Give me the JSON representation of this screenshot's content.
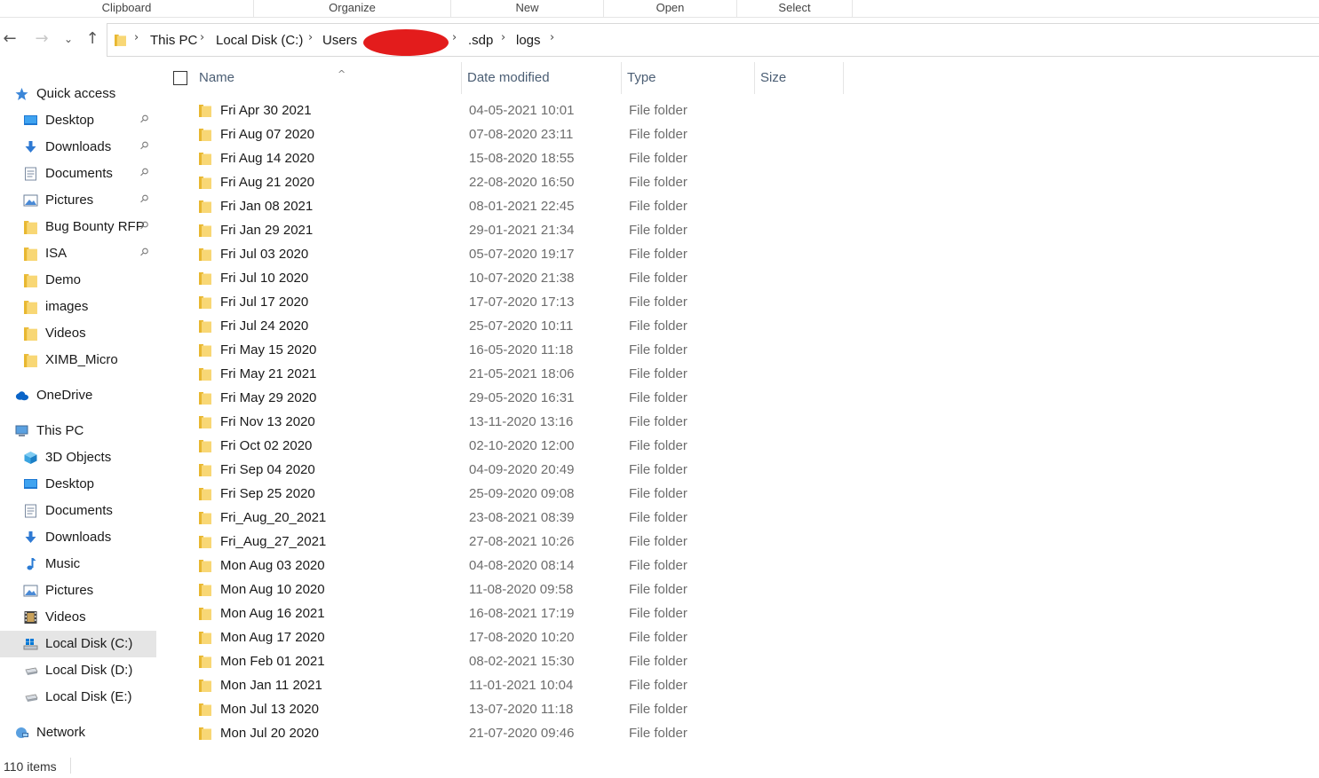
{
  "ribbon": {
    "groups": [
      "Clipboard",
      "Organize",
      "New",
      "Open",
      "Select"
    ]
  },
  "breadcrumb": {
    "items": [
      "This PC",
      "Local Disk (C:)",
      "Users",
      ".sdp",
      "logs"
    ],
    "redaction_color": "#e31c1c"
  },
  "nav": {
    "back_glyph": "←",
    "forward_glyph": "→",
    "recent_glyph": "⌄",
    "up_glyph": "↑"
  },
  "sidebar": {
    "items": [
      {
        "label": "Quick access",
        "icon": "star-icon",
        "level": 0,
        "pinned": false
      },
      {
        "label": "Desktop",
        "icon": "desktop-icon",
        "level": 1,
        "pinned": true
      },
      {
        "label": "Downloads",
        "icon": "downloads-icon",
        "level": 1,
        "pinned": true
      },
      {
        "label": "Documents",
        "icon": "documents-icon",
        "level": 1,
        "pinned": true
      },
      {
        "label": "Pictures",
        "icon": "pictures-icon",
        "level": 1,
        "pinned": true
      },
      {
        "label": "Bug Bounty RFP",
        "icon": "folder-icon",
        "level": 1,
        "pinned": true
      },
      {
        "label": "ISA",
        "icon": "folder-icon",
        "level": 1,
        "pinned": true
      },
      {
        "label": "Demo",
        "icon": "folder-icon",
        "level": 1,
        "pinned": false
      },
      {
        "label": "images",
        "icon": "folder-icon",
        "level": 1,
        "pinned": false
      },
      {
        "label": "Videos",
        "icon": "folder-icon",
        "level": 1,
        "pinned": false
      },
      {
        "label": "XIMB_Micro",
        "icon": "folder-icon",
        "level": 1,
        "pinned": false
      },
      {
        "label": "OneDrive",
        "icon": "cloud-icon",
        "level": 0,
        "pinned": false
      },
      {
        "label": "This PC",
        "icon": "computer-icon",
        "level": 0,
        "pinned": false
      },
      {
        "label": "3D Objects",
        "icon": "cube-icon",
        "level": 1,
        "pinned": false
      },
      {
        "label": "Desktop",
        "icon": "desktop-icon",
        "level": 1,
        "pinned": false
      },
      {
        "label": "Documents",
        "icon": "documents-icon",
        "level": 1,
        "pinned": false
      },
      {
        "label": "Downloads",
        "icon": "downloads-icon",
        "level": 1,
        "pinned": false
      },
      {
        "label": "Music",
        "icon": "music-icon",
        "level": 1,
        "pinned": false
      },
      {
        "label": "Pictures",
        "icon": "pictures-icon",
        "level": 1,
        "pinned": false
      },
      {
        "label": "Videos",
        "icon": "videos-icon",
        "level": 1,
        "pinned": false
      },
      {
        "label": "Local Disk (C:)",
        "icon": "windows-drive-icon",
        "level": 1,
        "pinned": false,
        "selected": true
      },
      {
        "label": "Local Disk (D:)",
        "icon": "drive-icon",
        "level": 1,
        "pinned": false
      },
      {
        "label": "Local Disk (E:)",
        "icon": "drive-icon",
        "level": 1,
        "pinned": false
      },
      {
        "label": "Network",
        "icon": "network-icon",
        "level": 0,
        "pinned": false
      }
    ],
    "pin_glyph": "📌"
  },
  "columns": {
    "name": "Name",
    "date": "Date modified",
    "type": "Type",
    "size": "Size",
    "sort_glyph": "^"
  },
  "files": [
    {
      "name": "Fri Apr 30 2021",
      "date": "04-05-2021 10:01",
      "type": "File folder"
    },
    {
      "name": "Fri Aug 07 2020",
      "date": "07-08-2020 23:11",
      "type": "File folder"
    },
    {
      "name": "Fri Aug 14 2020",
      "date": "15-08-2020 18:55",
      "type": "File folder"
    },
    {
      "name": "Fri Aug 21 2020",
      "date": "22-08-2020 16:50",
      "type": "File folder"
    },
    {
      "name": "Fri Jan 08 2021",
      "date": "08-01-2021 22:45",
      "type": "File folder"
    },
    {
      "name": "Fri Jan 29 2021",
      "date": "29-01-2021 21:34",
      "type": "File folder"
    },
    {
      "name": "Fri Jul 03 2020",
      "date": "05-07-2020 19:17",
      "type": "File folder"
    },
    {
      "name": "Fri Jul 10 2020",
      "date": "10-07-2020 21:38",
      "type": "File folder"
    },
    {
      "name": "Fri Jul 17 2020",
      "date": "17-07-2020 17:13",
      "type": "File folder"
    },
    {
      "name": "Fri Jul 24 2020",
      "date": "25-07-2020 10:11",
      "type": "File folder"
    },
    {
      "name": "Fri May 15 2020",
      "date": "16-05-2020 11:18",
      "type": "File folder"
    },
    {
      "name": "Fri May 21 2021",
      "date": "21-05-2021 18:06",
      "type": "File folder"
    },
    {
      "name": "Fri May 29 2020",
      "date": "29-05-2020 16:31",
      "type": "File folder"
    },
    {
      "name": "Fri Nov 13 2020",
      "date": "13-11-2020 13:16",
      "type": "File folder"
    },
    {
      "name": "Fri Oct 02 2020",
      "date": "02-10-2020 12:00",
      "type": "File folder"
    },
    {
      "name": "Fri Sep 04 2020",
      "date": "04-09-2020 20:49",
      "type": "File folder"
    },
    {
      "name": "Fri Sep 25 2020",
      "date": "25-09-2020 09:08",
      "type": "File folder"
    },
    {
      "name": "Fri_Aug_20_2021",
      "date": "23-08-2021 08:39",
      "type": "File folder"
    },
    {
      "name": "Fri_Aug_27_2021",
      "date": "27-08-2021 10:26",
      "type": "File folder"
    },
    {
      "name": "Mon Aug 03 2020",
      "date": "04-08-2020 08:14",
      "type": "File folder"
    },
    {
      "name": "Mon Aug 10 2020",
      "date": "11-08-2020 09:58",
      "type": "File folder"
    },
    {
      "name": "Mon Aug 16 2021",
      "date": "16-08-2021 17:19",
      "type": "File folder"
    },
    {
      "name": "Mon Aug 17 2020",
      "date": "17-08-2020 10:20",
      "type": "File folder"
    },
    {
      "name": "Mon Feb 01 2021",
      "date": "08-02-2021 15:30",
      "type": "File folder"
    },
    {
      "name": "Mon Jan 11 2021",
      "date": "11-01-2021 10:04",
      "type": "File folder"
    },
    {
      "name": "Mon Jul 13 2020",
      "date": "13-07-2020 11:18",
      "type": "File folder"
    },
    {
      "name": "Mon Jul 20 2020",
      "date": "21-07-2020 09:46",
      "type": "File folder"
    }
  ],
  "status": {
    "item_count": "110 items"
  },
  "colors": {
    "folder": "#f8d775",
    "folder_dark": "#e8b730",
    "accent": "#0078d7",
    "selected_bg": "#e5e5e5"
  }
}
